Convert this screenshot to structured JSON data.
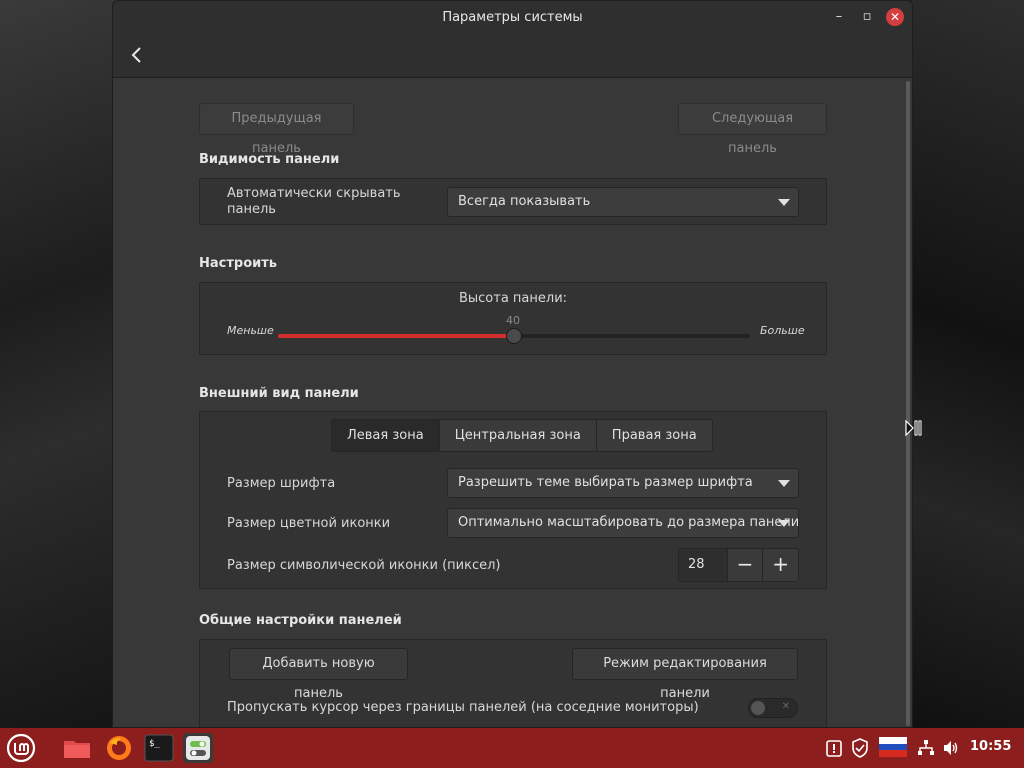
{
  "window": {
    "title": "Параметры системы"
  },
  "nav": {
    "prev_panel": "Предыдущая панель",
    "next_panel": "Следующая панель"
  },
  "visibility": {
    "section_title": "Видимость панели",
    "autohide_label": "Автоматически скрывать\nпанель",
    "autohide_value": "Всегда показывать"
  },
  "customize": {
    "section_title": "Настроить",
    "height_label": "Высота панели:",
    "height_value": "40",
    "height_fraction": 0.5,
    "less_label": "Меньше",
    "more_label": "Больше"
  },
  "appearance": {
    "section_title": "Внешний вид панели",
    "tabs": [
      "Левая зона",
      "Центральная зона",
      "Правая зона"
    ],
    "font_size_label": "Размер шрифта",
    "font_size_value": "Разрешить теме выбирать размер шрифта",
    "color_icon_label": "Размер цветной иконки",
    "color_icon_value": "Оптимально масштабировать до размера панели",
    "symbolic_icon_label": "Размер символической иконки (пиксел)",
    "symbolic_icon_value": "28",
    "minus": "−",
    "plus": "+"
  },
  "general": {
    "section_title": "Общие настройки панелей",
    "add_panel": "Добавить новую панель",
    "edit_mode": "Режим редактирования панели",
    "pass_cursor_label": "Пропускать курсор через границы панелей (на соседние мониторы)",
    "pass_cursor_enabled": false
  },
  "taskbar": {
    "clock": "10:55",
    "colors": {
      "bar": "#8c1e1e",
      "accent": "#d32f2f"
    }
  }
}
